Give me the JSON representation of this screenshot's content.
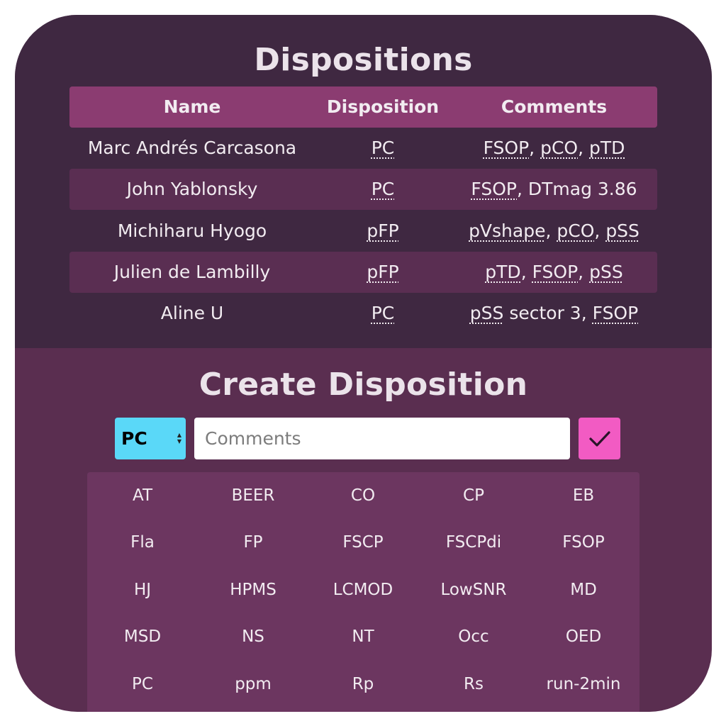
{
  "dispositions": {
    "title": "Dispositions",
    "columns": [
      "Name",
      "Disposition",
      "Comments"
    ],
    "rows": [
      {
        "name": "Marc Andrés Carcasona",
        "disposition": "PC",
        "comments": [
          {
            "text": "FSOP",
            "abbr": true
          },
          {
            "text": ", ",
            "abbr": false
          },
          {
            "text": "pCO",
            "abbr": true
          },
          {
            "text": ", ",
            "abbr": false
          },
          {
            "text": "pTD",
            "abbr": true
          }
        ]
      },
      {
        "name": "John Yablonsky",
        "disposition": "PC",
        "comments": [
          {
            "text": "FSOP",
            "abbr": true
          },
          {
            "text": ", DTmag 3.86",
            "abbr": false
          }
        ]
      },
      {
        "name": "Michiharu Hyogo",
        "disposition": "pFP",
        "comments": [
          {
            "text": "pVshape",
            "abbr": true
          },
          {
            "text": ", ",
            "abbr": false
          },
          {
            "text": "pCO",
            "abbr": true
          },
          {
            "text": ", ",
            "abbr": false
          },
          {
            "text": "pSS",
            "abbr": true
          }
        ]
      },
      {
        "name": "Julien de Lambilly",
        "disposition": "pFP",
        "comments": [
          {
            "text": "pTD",
            "abbr": true
          },
          {
            "text": ", ",
            "abbr": false
          },
          {
            "text": "FSOP",
            "abbr": true
          },
          {
            "text": ", ",
            "abbr": false
          },
          {
            "text": "pSS",
            "abbr": true
          }
        ]
      },
      {
        "name": "Aline U",
        "disposition": "PC",
        "comments": [
          {
            "text": "pSS",
            "abbr": true
          },
          {
            "text": " sector 3, ",
            "abbr": false
          },
          {
            "text": "FSOP",
            "abbr": true
          }
        ]
      }
    ]
  },
  "create": {
    "title": "Create Disposition",
    "selected_disposition": "PC",
    "comments_placeholder": "Comments",
    "submit_icon": "check-icon",
    "tags": [
      "AT",
      "BEER",
      "CO",
      "CP",
      "EB",
      "Fla",
      "FP",
      "FSCP",
      "FSCPdi",
      "FSOP",
      "HJ",
      "HPMS",
      "LCMOD",
      "LowSNR",
      "MD",
      "MSD",
      "NS",
      "NT",
      "Occ",
      "OED",
      "PC",
      "ppm",
      "Rp",
      "Rs",
      "run-2min"
    ]
  },
  "colors": {
    "card_top": "#3f2841",
    "card_bottom": "#5a2e50",
    "header_row": "#8b3c71",
    "striped_row": "#5a2e52",
    "select": "#5ad8f8",
    "submit": "#f25bc3",
    "tag_panel": "#6c3660"
  }
}
